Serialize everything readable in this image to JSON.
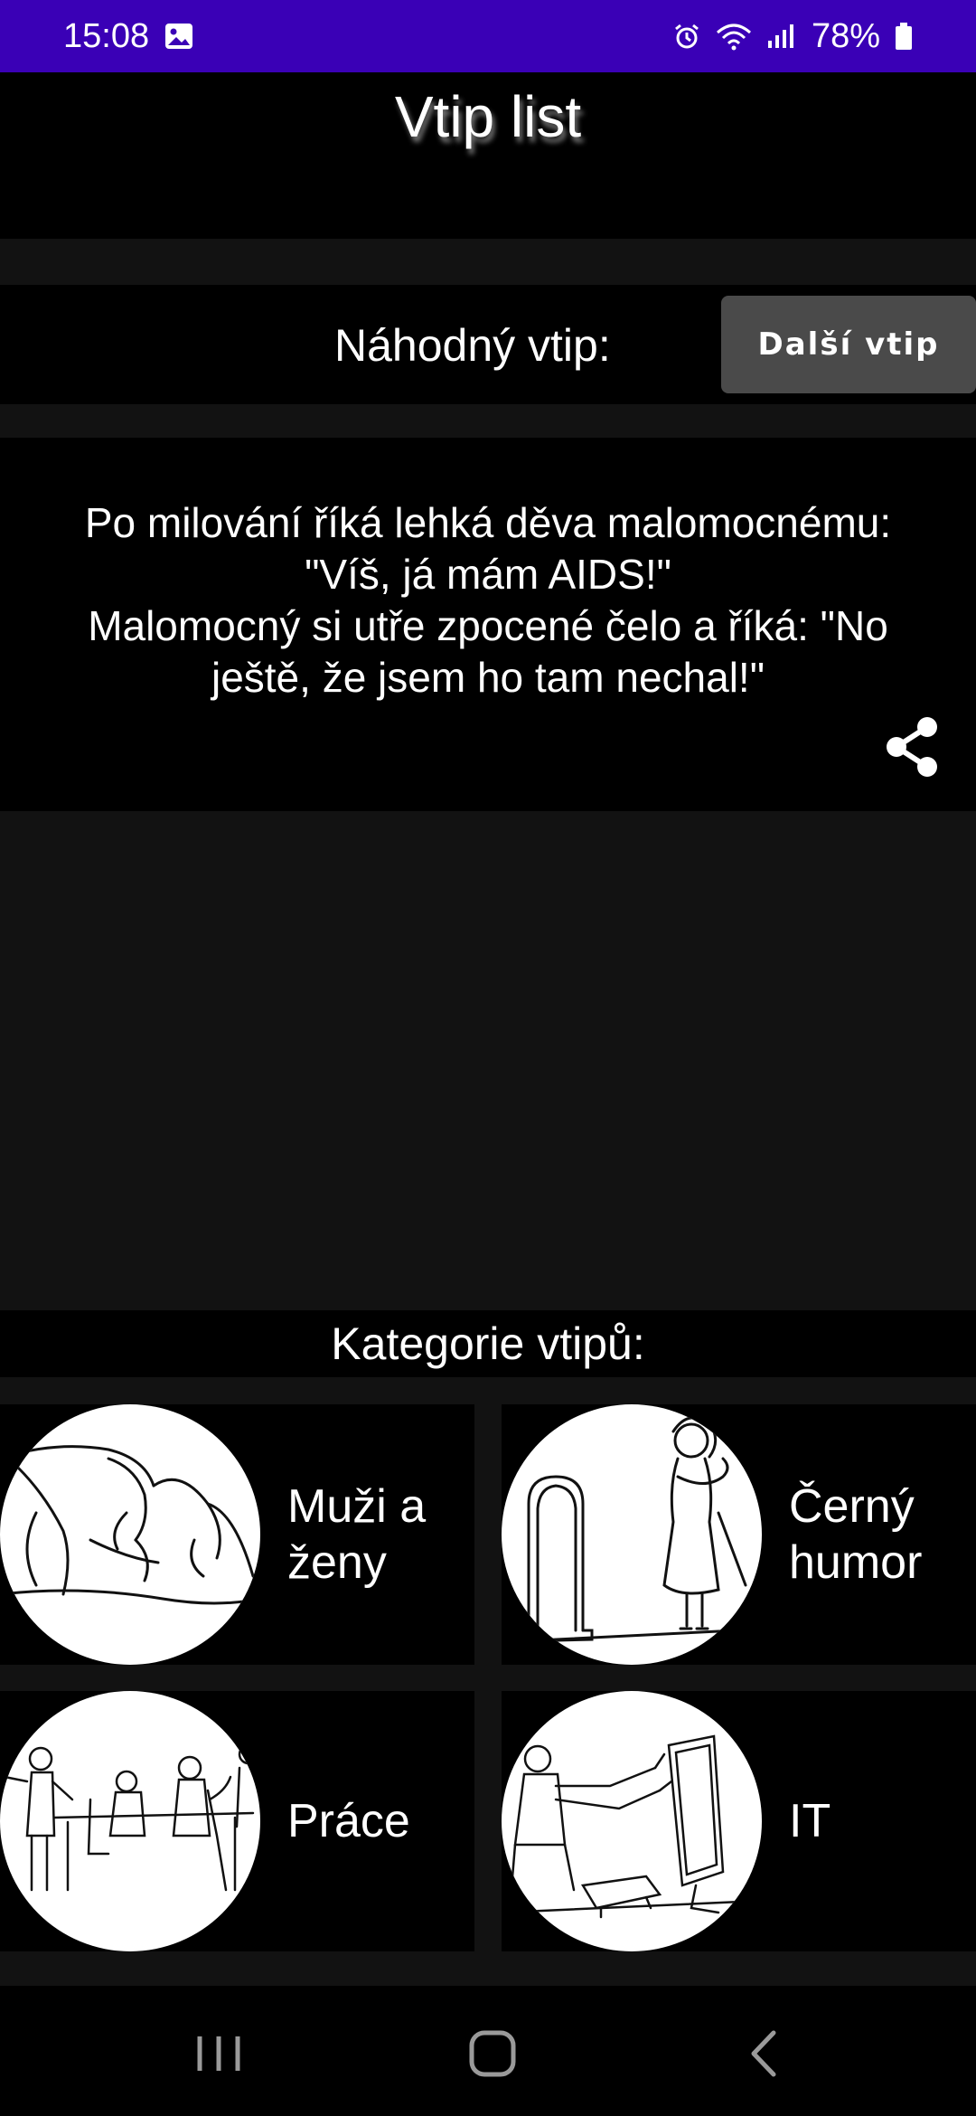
{
  "status_bar": {
    "time": "15:08",
    "battery": "78%",
    "icons": [
      "gallery-icon",
      "alarm-icon",
      "wifi-icon",
      "signal-icon",
      "battery-icon"
    ],
    "background": "#3a00b6"
  },
  "header": {
    "title": "Vtip list"
  },
  "random": {
    "label": "Náhodný vtip:",
    "next_button": "Další vtip"
  },
  "joke": {
    "text": "Po milování říká lehká děva malomocnému:\n\"Víš, já mám AIDS!\"\nMalomocný si utře zpocené čelo a říká: \"No\nještě, že jsem ho tam nechal!\"",
    "share_icon": "share-icon"
  },
  "categories": {
    "title": "Kategorie vtipů:",
    "items": [
      {
        "label": "Muži a\nženy",
        "image": "couple-sketch"
      },
      {
        "label": "Černý\nhumor",
        "image": "grave-sketch"
      },
      {
        "label": "Práce",
        "image": "office-sketch"
      },
      {
        "label": "IT",
        "image": "computer-sketch"
      }
    ]
  },
  "nav_bar": {
    "icons": [
      "recent-apps-icon",
      "home-icon",
      "back-icon"
    ]
  }
}
